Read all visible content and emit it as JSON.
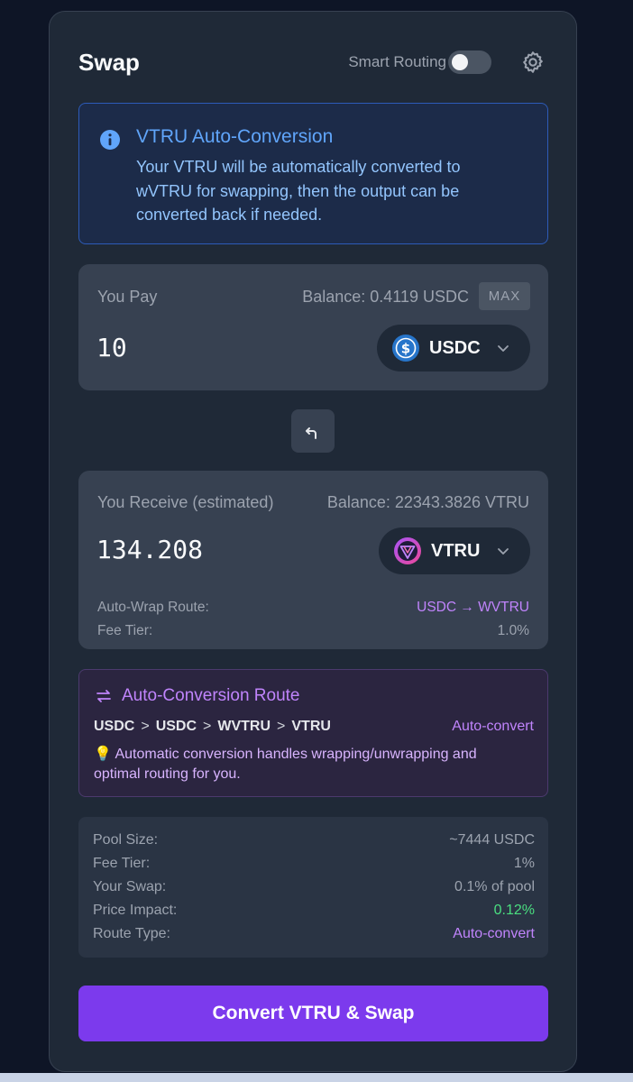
{
  "header": {
    "title": "Swap",
    "smart_routing_label": "Smart Routing",
    "smart_routing_enabled": false
  },
  "info": {
    "title": "VTRU Auto-Conversion",
    "text": "Your VTRU will be automatically converted to wVTRU for swapping, then the output can be converted back if needed."
  },
  "pay": {
    "label": "You Pay",
    "balance": "Balance: 0.4119 USDC",
    "max_label": "MAX",
    "amount": "10",
    "token": "USDC"
  },
  "receive": {
    "label": "You Receive (estimated)",
    "balance": "Balance: 22343.3826 VTRU",
    "amount": "134.208",
    "token": "VTRU",
    "route_label": "Auto-Wrap Route:",
    "route_value": "USDC → WVTRU",
    "fee_label": "Fee Tier:",
    "fee_value": "1.0%"
  },
  "route": {
    "title": "Auto-Conversion Route",
    "path": [
      "USDC",
      "USDC",
      "WVTRU",
      "VTRU"
    ],
    "separator": ">",
    "tag": "Auto-convert",
    "note": "💡 Automatic conversion handles wrapping/unwrapping and optimal routing for you."
  },
  "stats": [
    {
      "label": "Pool Size:",
      "value": "~7444 USDC",
      "color": ""
    },
    {
      "label": "Fee Tier:",
      "value": "1%",
      "color": ""
    },
    {
      "label": "Your Swap:",
      "value": "0.1% of pool",
      "color": ""
    },
    {
      "label": "Price Impact:",
      "value": "0.12%",
      "color": "#4ade80"
    },
    {
      "label": "Route Type:",
      "value": "Auto-convert",
      "color": "#c084fc"
    }
  ],
  "cta_label": "Convert VTRU & Swap",
  "colors": {
    "accent": "#7c3aed",
    "info_blue": "#60a5fa",
    "route_purple": "#c084fc",
    "positive_green": "#4ade80"
  }
}
